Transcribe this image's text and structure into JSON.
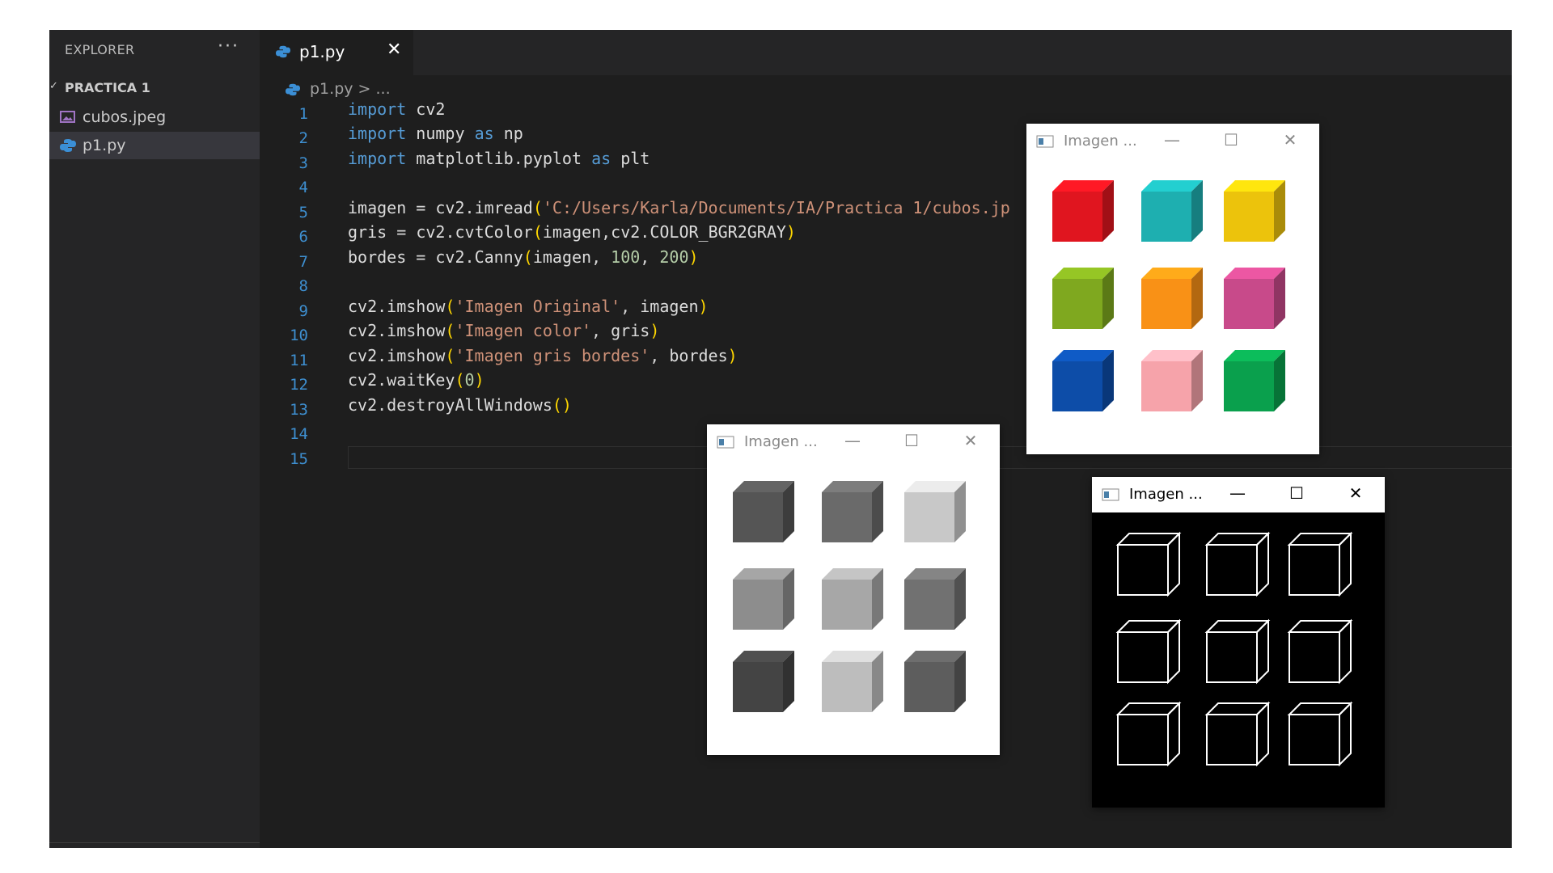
{
  "explorer": {
    "title": "EXPLORER",
    "more": "···",
    "folder": "PRACTICA 1",
    "files": [
      {
        "name": "cubos.jpeg",
        "icon": "image-file-icon"
      },
      {
        "name": "p1.py",
        "icon": "python-file-icon",
        "selected": true
      }
    ]
  },
  "tab": {
    "name": "p1.py",
    "close": "✕"
  },
  "breadcrumb": {
    "text": "p1.py > ..."
  },
  "line_numbers": [
    "1",
    "2",
    "3",
    "4",
    "5",
    "6",
    "7",
    "8",
    "9",
    "10",
    "11",
    "12",
    "13",
    "14",
    "15"
  ],
  "code_lines": [
    "import cv2",
    "import numpy as np",
    "import matplotlib.pyplot as plt",
    "",
    "imagen = cv2.imread('C:/Users/Karla/Documents/IA/Practica 1/cubos.jp",
    "gris = cv2.cvtColor(imagen,cv2.COLOR_BGR2GRAY)",
    "bordes = cv2.Canny(imagen, 100, 200)",
    "",
    "cv2.imshow('Imagen Original', imagen)",
    "cv2.imshow('Imagen color', gris)",
    "cv2.imshow('Imagen gris bordes', bordes)",
    "cv2.waitKey(0)",
    "cv2.destroyAllWindows()",
    "",
    ""
  ],
  "windows": {
    "original": {
      "title": "Imagen ...",
      "colors": [
        "#e0151f",
        "#1eafb0",
        "#ecc30c",
        "#7fa81f",
        "#f99116",
        "#c84a8a",
        "#0d4da8",
        "#f6a3aa",
        "#0aa04d"
      ]
    },
    "gray": {
      "title": "Imagen ...",
      "colors": [
        "#555555",
        "#6a6a6a",
        "#c8c8c8",
        "#8d8d8d",
        "#a7a7a7",
        "#717171",
        "#444444",
        "#bdbdbd",
        "#5d5d5d"
      ]
    },
    "edges": {
      "title": "Imagen ..."
    }
  },
  "window_controls": {
    "minimize": "—",
    "maximize": "☐",
    "close": "✕"
  },
  "colors": {
    "editor_bg": "#1e1e1e",
    "sidebar_bg": "#252526",
    "keyword": "#569cd6",
    "string": "#ce9178",
    "number": "#b5cea8",
    "bracket": "#ffd700"
  }
}
